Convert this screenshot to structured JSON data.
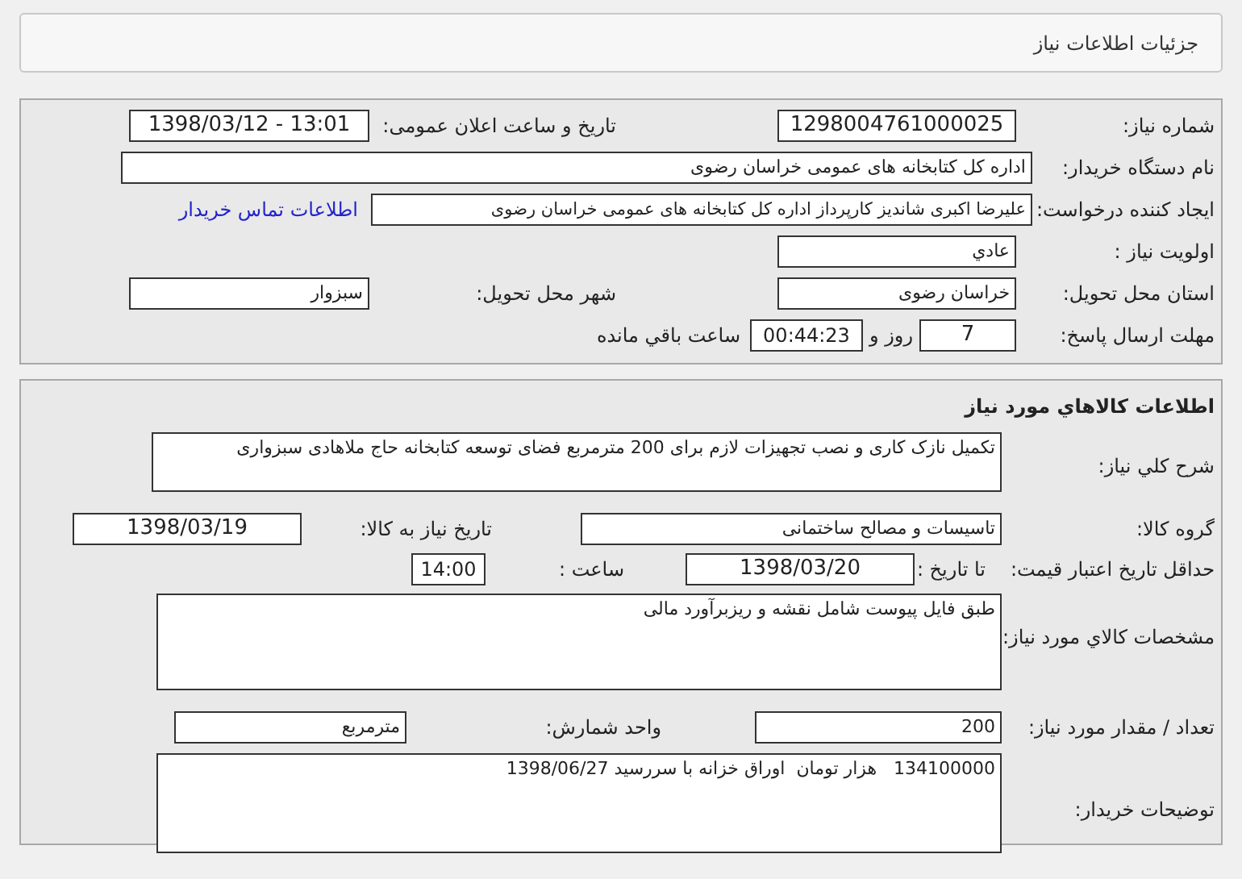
{
  "page_title": "جزئیات اطلاعات نیاز",
  "need_info": {
    "need_number": {
      "label": "شماره نیاز:",
      "value": "1298004761000025"
    },
    "announce_datetime": {
      "label": "تاریخ و ساعت اعلان عمومی:",
      "value": "1398/03/12 - 13:01"
    },
    "buyer_org": {
      "label": "نام دستگاه خریدار:",
      "value": "اداره کل  کتابخانه های عمومی خراسان رضوی"
    },
    "requester": {
      "label": "ایجاد کننده درخواست:",
      "value": "علیرضا اکبری شاندیز کارپرداز اداره کل  کتابخانه های عمومی خراسان رضوی"
    },
    "contact_link": "اطلاعات تماس خریدار",
    "priority": {
      "label": "اولویت نیاز :",
      "value": "عادي"
    },
    "province": {
      "label": "استان محل تحویل:",
      "value": "خراسان رضوی"
    },
    "city": {
      "label": "شهر محل تحویل:",
      "value": "سبزوار"
    },
    "deadline": {
      "label": "مهلت ارسال پاسخ:",
      "days": "7",
      "days_unit": "روز و",
      "time": "00:44:23",
      "time_suffix": "ساعت باقي مانده"
    }
  },
  "goods_info": {
    "title": "اطلاعات کالاهاي مورد نياز",
    "summary": {
      "label": "شرح کلي نياز:",
      "value": "تکمیل نازک کاری و نصب تجهیزات لازم برای 200 مترمربع فضای توسعه کتابخانه حاج ملاهادی سبزواری"
    },
    "goods_group": {
      "label": "گروه کالا:",
      "value": "تاسیسات و مصالح ساختمانی"
    },
    "need_date": {
      "label": "تاریخ نیاز به کالا:",
      "value": "1398/03/19"
    },
    "price_validity": {
      "label": "حداقل تاریخ اعتبار قیمت:",
      "date_label": "تا تاریخ :",
      "date": "1398/03/20",
      "time_label": "ساعت :",
      "time": "14:00"
    },
    "specs": {
      "label": "مشخصات کالاي مورد نياز:",
      "value": "طبق فایل پیوست شامل نقشه و ریزبرآورد مالی"
    },
    "quantity": {
      "label": "تعداد / مقدار مورد نیاز:",
      "value": "200"
    },
    "unit": {
      "label": "واحد شمارش:",
      "value": "مترمربع"
    },
    "buyer_notes": {
      "label": "توضیحات خریدار:",
      "value": "134100000   هزار تومان  اوراق خزانه با سررسید 1398/06/27"
    }
  }
}
